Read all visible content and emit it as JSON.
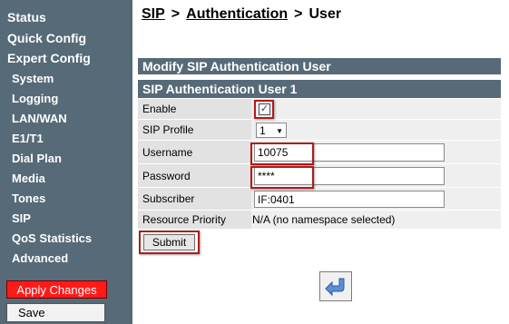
{
  "sidebar": {
    "main": [
      "Status",
      "Quick Config",
      "Expert Config"
    ],
    "sub": [
      "System",
      "Logging",
      "LAN/WAN",
      "E1/T1",
      "Dial Plan",
      "Media",
      "Tones",
      "SIP",
      "QoS Statistics",
      "Advanced"
    ],
    "apply_label": "Apply Changes",
    "save_label": "Save"
  },
  "breadcrumb": {
    "sip": "SIP",
    "sep1": ">",
    "auth": "Authentication",
    "sep2": ">",
    "user": "User"
  },
  "form": {
    "title": "Modify SIP Authentication User",
    "subtitle": "SIP Authentication User 1",
    "enable_label": "Enable",
    "enable_check": "✓",
    "profile_label": "SIP Profile",
    "profile_value": "1",
    "username_label": "Username",
    "username_value": "10075",
    "password_label": "Password",
    "password_value": "****",
    "subscriber_label": "Subscriber",
    "subscriber_value": "IF:0401",
    "priority_label": "Resource Priority",
    "priority_value": "N/A (no namespace selected)",
    "submit_label": "Submit"
  },
  "colors": {
    "sidebar": "#566a77",
    "header": "#566a77",
    "apply": "#ff1a1a",
    "highlight": "#b11b1b"
  },
  "icons": {
    "back": "back-arrow-icon",
    "dropdown": "chevron-down-icon"
  }
}
